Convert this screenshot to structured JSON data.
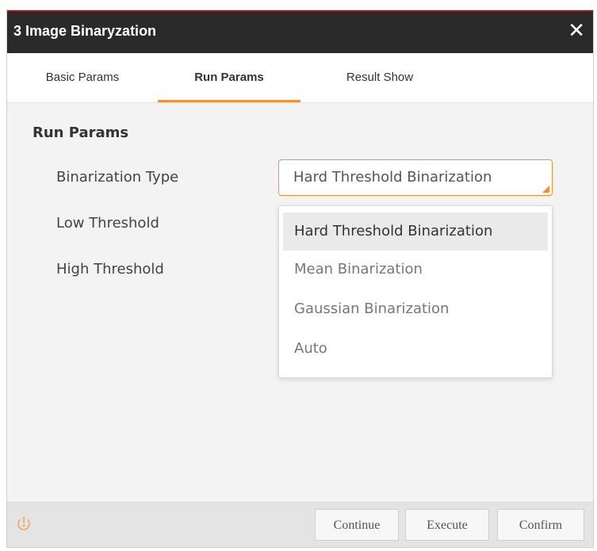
{
  "window": {
    "title": "3 Image Binaryzation",
    "close_glyph": "✕"
  },
  "tabs": [
    {
      "label": "Basic Params",
      "active": false
    },
    {
      "label": "Run Params",
      "active": true
    },
    {
      "label": "Result Show",
      "active": false
    }
  ],
  "run_params": {
    "section_title": "Run Params",
    "fields": [
      {
        "label": "Binarization Type"
      },
      {
        "label": "Low Threshold"
      },
      {
        "label": "High Threshold"
      }
    ],
    "binarization_type": {
      "value": "Hard Threshold Binarization",
      "options": [
        "Hard Threshold Binarization",
        "Mean Binarization",
        "Gaussian Binarization",
        "Auto"
      ]
    }
  },
  "footer": {
    "reset_icon": "reset-icon",
    "buttons": [
      {
        "label": "Continue"
      },
      {
        "label": "Execute"
      },
      {
        "label": "Confirm"
      }
    ]
  },
  "colors": {
    "accent": "#f0913a",
    "titlebar": "#2a2a2a",
    "footer": "#e4e4e4"
  }
}
